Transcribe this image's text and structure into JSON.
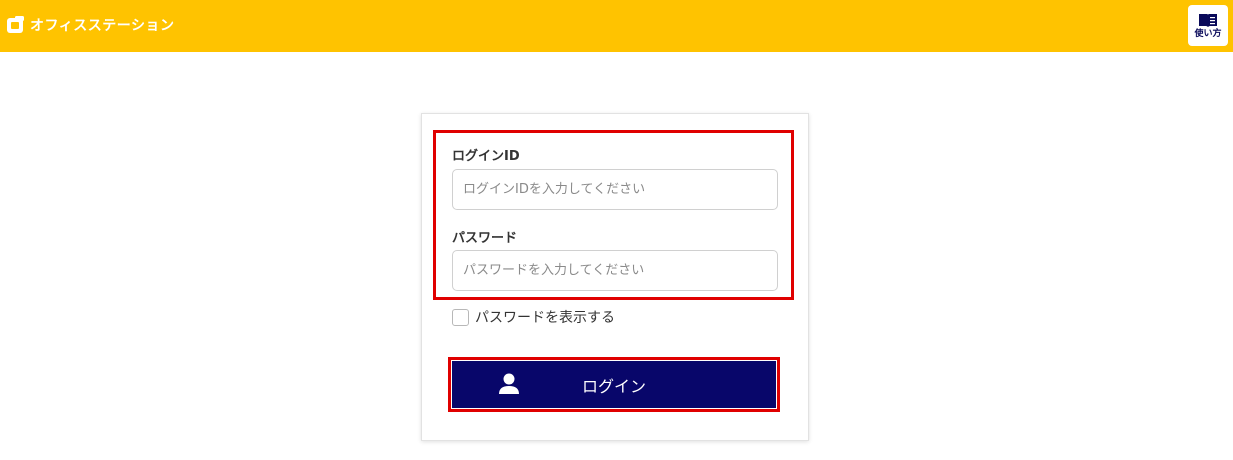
{
  "header": {
    "brand_name": "オフィスステーション",
    "help_label": "使い方",
    "background_color": "#ffc300"
  },
  "login_form": {
    "login_id_label": "ログインID",
    "login_id_placeholder": "ログインIDを入力してください",
    "login_id_value": "",
    "password_label": "パスワード",
    "password_placeholder": "パスワードを入力してください",
    "password_value": "",
    "show_password_label": "パスワードを表示する",
    "show_password_checked": false,
    "login_button_label": "ログイン",
    "login_button_color": "#08066a"
  },
  "icons": {
    "brand": "brand-logo-icon",
    "help": "book-icon",
    "login": "user-icon"
  },
  "highlight_color": "#e00000"
}
